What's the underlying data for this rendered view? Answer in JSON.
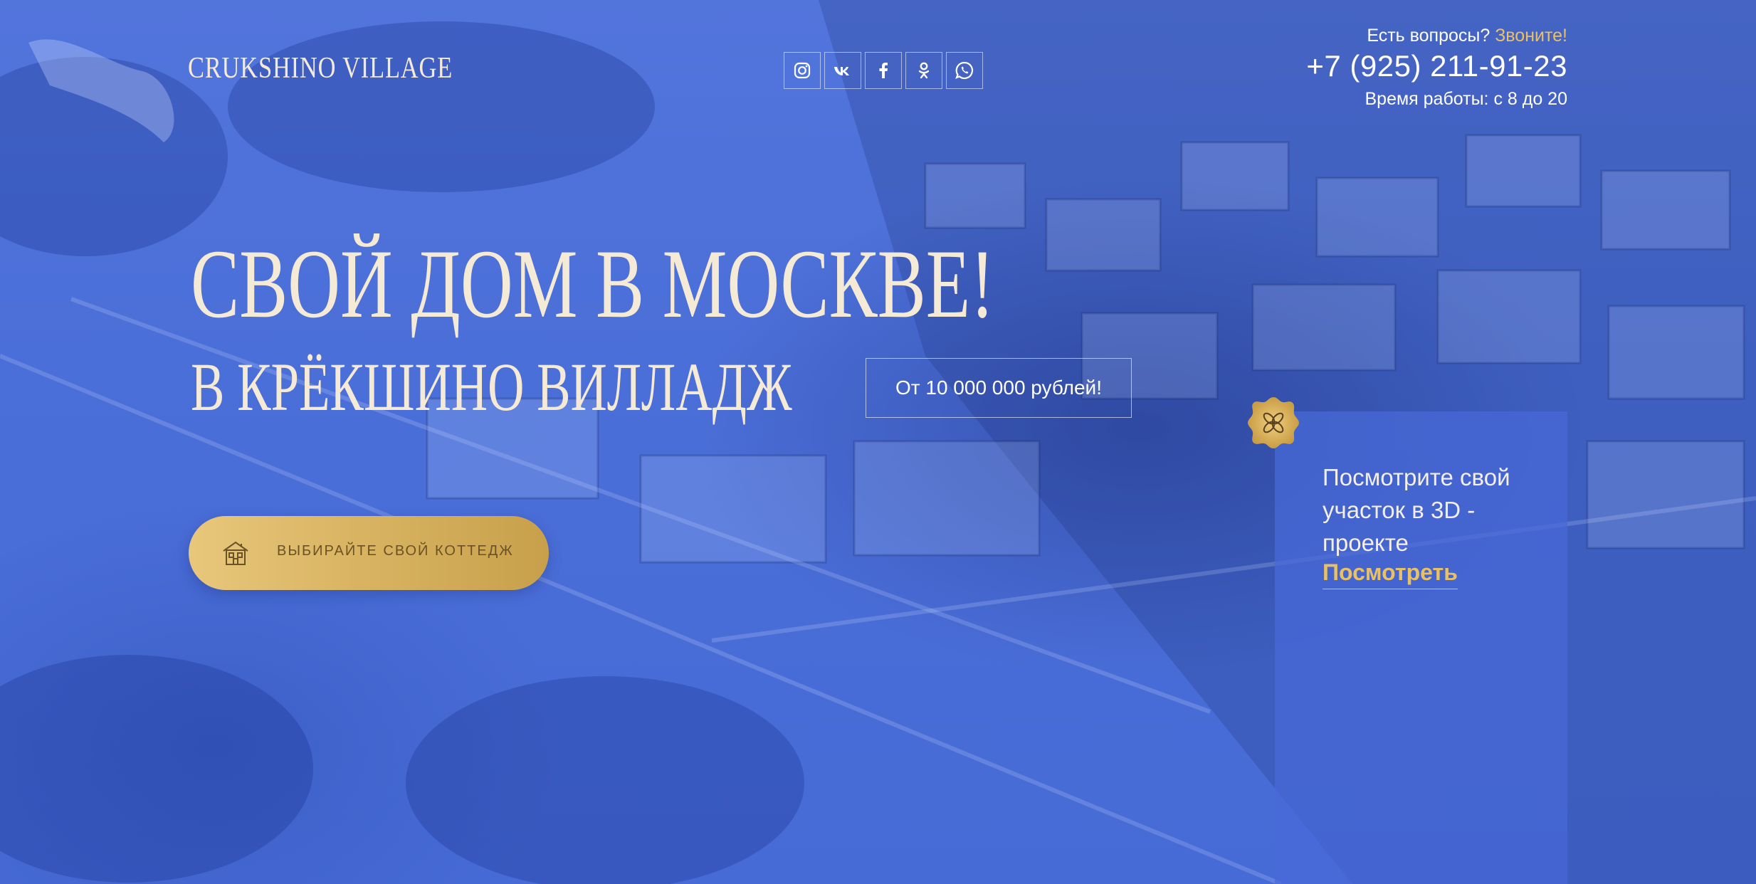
{
  "header": {
    "logo": "CRUKSHINO VILLAGE",
    "socials": [
      {
        "icon": "instagram-icon"
      },
      {
        "icon": "vk-icon"
      },
      {
        "icon": "facebook-icon"
      },
      {
        "icon": "odnoklassniki-icon"
      },
      {
        "icon": "whatsapp-icon"
      }
    ],
    "contact": {
      "question": "Есть вопросы?",
      "call_link": "Звоните!",
      "phone": "+7 (925) 211-91-23",
      "hours": "Время работы: с 8 до 20"
    }
  },
  "hero": {
    "title": "СВОЙ ДОМ В МОСКВЕ!",
    "subtitle": "В КРЁКШИНО ВИЛЛАДЖ",
    "price": "От 10 000 000 рублей!",
    "cta_label": "ВЫБИРАЙТЕ СВОЙ КОТТЕДЖ",
    "cta_icon": "house-icon"
  },
  "panel": {
    "badge_icon": "flower-badge-icon",
    "text": "Посмотрите свой участок в 3D - проекте",
    "link": "Посмотреть"
  },
  "colors": {
    "accent_gold": "#e8c066",
    "title_cream": "#f5ead6",
    "overlay_blue": "#4a6fd6"
  }
}
